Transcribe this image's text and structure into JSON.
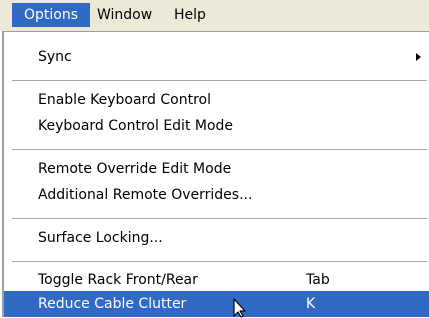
{
  "menubar": {
    "items": [
      {
        "label": "Options"
      },
      {
        "label": "Window"
      },
      {
        "label": "Help"
      }
    ]
  },
  "menu": {
    "sync": {
      "label": "Sync"
    },
    "enable_keyboard_control": {
      "label": "Enable Keyboard Control"
    },
    "keyboard_control_edit_mode": {
      "label": "Keyboard Control Edit Mode"
    },
    "remote_override_edit_mode": {
      "label": "Remote Override Edit Mode"
    },
    "additional_remote_overrides": {
      "label": "Additional Remote Overrides..."
    },
    "surface_locking": {
      "label": "Surface Locking..."
    },
    "toggle_rack": {
      "label": "Toggle Rack Front/Rear",
      "shortcut": "Tab"
    },
    "reduce_cable_clutter": {
      "label": "Reduce Cable Clutter",
      "shortcut": "K"
    }
  },
  "colors": {
    "highlight": "#316ac5",
    "menubar_bg": "#ece9d8",
    "separator": "#aca899"
  }
}
